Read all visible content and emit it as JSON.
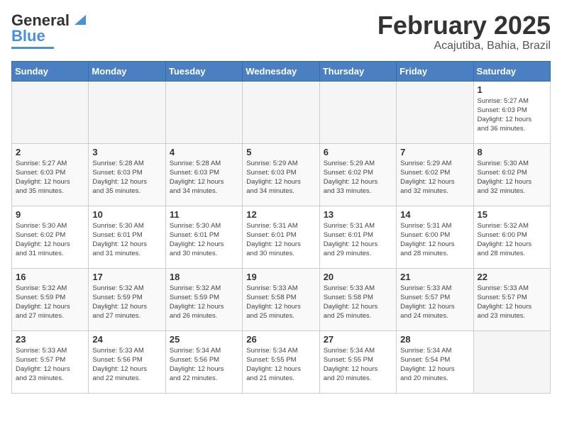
{
  "header": {
    "logo_general": "General",
    "logo_blue": "Blue",
    "month_year": "February 2025",
    "location": "Acajutiba, Bahia, Brazil"
  },
  "days_of_week": [
    "Sunday",
    "Monday",
    "Tuesday",
    "Wednesday",
    "Thursday",
    "Friday",
    "Saturday"
  ],
  "weeks": [
    [
      {
        "day": "",
        "info": ""
      },
      {
        "day": "",
        "info": ""
      },
      {
        "day": "",
        "info": ""
      },
      {
        "day": "",
        "info": ""
      },
      {
        "day": "",
        "info": ""
      },
      {
        "day": "",
        "info": ""
      },
      {
        "day": "1",
        "info": "Sunrise: 5:27 AM\nSunset: 6:03 PM\nDaylight: 12 hours\nand 36 minutes."
      }
    ],
    [
      {
        "day": "2",
        "info": "Sunrise: 5:27 AM\nSunset: 6:03 PM\nDaylight: 12 hours\nand 35 minutes."
      },
      {
        "day": "3",
        "info": "Sunrise: 5:28 AM\nSunset: 6:03 PM\nDaylight: 12 hours\nand 35 minutes."
      },
      {
        "day": "4",
        "info": "Sunrise: 5:28 AM\nSunset: 6:03 PM\nDaylight: 12 hours\nand 34 minutes."
      },
      {
        "day": "5",
        "info": "Sunrise: 5:29 AM\nSunset: 6:03 PM\nDaylight: 12 hours\nand 34 minutes."
      },
      {
        "day": "6",
        "info": "Sunrise: 5:29 AM\nSunset: 6:02 PM\nDaylight: 12 hours\nand 33 minutes."
      },
      {
        "day": "7",
        "info": "Sunrise: 5:29 AM\nSunset: 6:02 PM\nDaylight: 12 hours\nand 32 minutes."
      },
      {
        "day": "8",
        "info": "Sunrise: 5:30 AM\nSunset: 6:02 PM\nDaylight: 12 hours\nand 32 minutes."
      }
    ],
    [
      {
        "day": "9",
        "info": "Sunrise: 5:30 AM\nSunset: 6:02 PM\nDaylight: 12 hours\nand 31 minutes."
      },
      {
        "day": "10",
        "info": "Sunrise: 5:30 AM\nSunset: 6:01 PM\nDaylight: 12 hours\nand 31 minutes."
      },
      {
        "day": "11",
        "info": "Sunrise: 5:30 AM\nSunset: 6:01 PM\nDaylight: 12 hours\nand 30 minutes."
      },
      {
        "day": "12",
        "info": "Sunrise: 5:31 AM\nSunset: 6:01 PM\nDaylight: 12 hours\nand 30 minutes."
      },
      {
        "day": "13",
        "info": "Sunrise: 5:31 AM\nSunset: 6:01 PM\nDaylight: 12 hours\nand 29 minutes."
      },
      {
        "day": "14",
        "info": "Sunrise: 5:31 AM\nSunset: 6:00 PM\nDaylight: 12 hours\nand 28 minutes."
      },
      {
        "day": "15",
        "info": "Sunrise: 5:32 AM\nSunset: 6:00 PM\nDaylight: 12 hours\nand 28 minutes."
      }
    ],
    [
      {
        "day": "16",
        "info": "Sunrise: 5:32 AM\nSunset: 5:59 PM\nDaylight: 12 hours\nand 27 minutes."
      },
      {
        "day": "17",
        "info": "Sunrise: 5:32 AM\nSunset: 5:59 PM\nDaylight: 12 hours\nand 27 minutes."
      },
      {
        "day": "18",
        "info": "Sunrise: 5:32 AM\nSunset: 5:59 PM\nDaylight: 12 hours\nand 26 minutes."
      },
      {
        "day": "19",
        "info": "Sunrise: 5:33 AM\nSunset: 5:58 PM\nDaylight: 12 hours\nand 25 minutes."
      },
      {
        "day": "20",
        "info": "Sunrise: 5:33 AM\nSunset: 5:58 PM\nDaylight: 12 hours\nand 25 minutes."
      },
      {
        "day": "21",
        "info": "Sunrise: 5:33 AM\nSunset: 5:57 PM\nDaylight: 12 hours\nand 24 minutes."
      },
      {
        "day": "22",
        "info": "Sunrise: 5:33 AM\nSunset: 5:57 PM\nDaylight: 12 hours\nand 23 minutes."
      }
    ],
    [
      {
        "day": "23",
        "info": "Sunrise: 5:33 AM\nSunset: 5:57 PM\nDaylight: 12 hours\nand 23 minutes."
      },
      {
        "day": "24",
        "info": "Sunrise: 5:33 AM\nSunset: 5:56 PM\nDaylight: 12 hours\nand 22 minutes."
      },
      {
        "day": "25",
        "info": "Sunrise: 5:34 AM\nSunset: 5:56 PM\nDaylight: 12 hours\nand 22 minutes."
      },
      {
        "day": "26",
        "info": "Sunrise: 5:34 AM\nSunset: 5:55 PM\nDaylight: 12 hours\nand 21 minutes."
      },
      {
        "day": "27",
        "info": "Sunrise: 5:34 AM\nSunset: 5:55 PM\nDaylight: 12 hours\nand 20 minutes."
      },
      {
        "day": "28",
        "info": "Sunrise: 5:34 AM\nSunset: 5:54 PM\nDaylight: 12 hours\nand 20 minutes."
      },
      {
        "day": "",
        "info": ""
      }
    ]
  ]
}
